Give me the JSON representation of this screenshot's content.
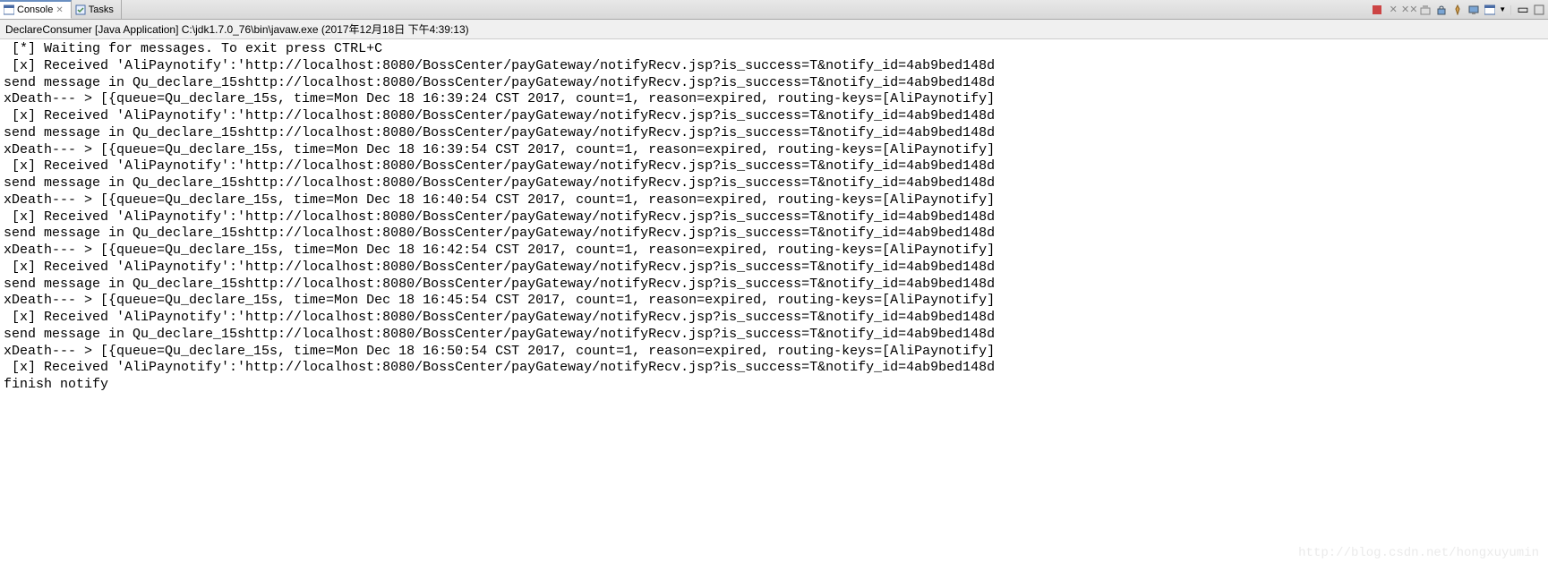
{
  "tabs": [
    {
      "label": "Console",
      "active": true,
      "icon": "console-icon"
    },
    {
      "label": "Tasks",
      "active": false,
      "icon": "tasks-icon"
    }
  ],
  "toolbar": {
    "icons": [
      "terminate-icon",
      "terminate-all-icon",
      "remove-all-icon",
      "clear-icon",
      "scroll-lock-icon",
      "pin-icon",
      "display-icon",
      "open-console-icon",
      "minimize-icon",
      "maximize-icon"
    ]
  },
  "launch": "DeclareConsumer [Java Application] C:\\jdk1.7.0_76\\bin\\javaw.exe (2017年12月18日 下午4:39:13)",
  "output": [
    " [*] Waiting for messages. To exit press CTRL+C",
    " [x] Received 'AliPaynotify':'http://localhost:8080/BossCenter/payGateway/notifyRecv.jsp?is_success=T&notify_id=4ab9bed148d",
    "send message in Qu_declare_15shttp://localhost:8080/BossCenter/payGateway/notifyRecv.jsp?is_success=T&notify_id=4ab9bed148d",
    "xDeath--- > [{queue=Qu_declare_15s, time=Mon Dec 18 16:39:24 CST 2017, count=1, reason=expired, routing-keys=[AliPaynotify]",
    " [x] Received 'AliPaynotify':'http://localhost:8080/BossCenter/payGateway/notifyRecv.jsp?is_success=T&notify_id=4ab9bed148d",
    "send message in Qu_declare_15shttp://localhost:8080/BossCenter/payGateway/notifyRecv.jsp?is_success=T&notify_id=4ab9bed148d",
    "xDeath--- > [{queue=Qu_declare_15s, time=Mon Dec 18 16:39:54 CST 2017, count=1, reason=expired, routing-keys=[AliPaynotify]",
    " [x] Received 'AliPaynotify':'http://localhost:8080/BossCenter/payGateway/notifyRecv.jsp?is_success=T&notify_id=4ab9bed148d",
    "send message in Qu_declare_15shttp://localhost:8080/BossCenter/payGateway/notifyRecv.jsp?is_success=T&notify_id=4ab9bed148d",
    "xDeath--- > [{queue=Qu_declare_15s, time=Mon Dec 18 16:40:54 CST 2017, count=1, reason=expired, routing-keys=[AliPaynotify]",
    " [x] Received 'AliPaynotify':'http://localhost:8080/BossCenter/payGateway/notifyRecv.jsp?is_success=T&notify_id=4ab9bed148d",
    "send message in Qu_declare_15shttp://localhost:8080/BossCenter/payGateway/notifyRecv.jsp?is_success=T&notify_id=4ab9bed148d",
    "xDeath--- > [{queue=Qu_declare_15s, time=Mon Dec 18 16:42:54 CST 2017, count=1, reason=expired, routing-keys=[AliPaynotify]",
    " [x] Received 'AliPaynotify':'http://localhost:8080/BossCenter/payGateway/notifyRecv.jsp?is_success=T&notify_id=4ab9bed148d",
    "send message in Qu_declare_15shttp://localhost:8080/BossCenter/payGateway/notifyRecv.jsp?is_success=T&notify_id=4ab9bed148d",
    "xDeath--- > [{queue=Qu_declare_15s, time=Mon Dec 18 16:45:54 CST 2017, count=1, reason=expired, routing-keys=[AliPaynotify]",
    " [x] Received 'AliPaynotify':'http://localhost:8080/BossCenter/payGateway/notifyRecv.jsp?is_success=T&notify_id=4ab9bed148d",
    "send message in Qu_declare_15shttp://localhost:8080/BossCenter/payGateway/notifyRecv.jsp?is_success=T&notify_id=4ab9bed148d",
    "xDeath--- > [{queue=Qu_declare_15s, time=Mon Dec 18 16:50:54 CST 2017, count=1, reason=expired, routing-keys=[AliPaynotify]",
    " [x] Received 'AliPaynotify':'http://localhost:8080/BossCenter/payGateway/notifyRecv.jsp?is_success=T&notify_id=4ab9bed148d",
    "finish notify"
  ],
  "watermark": "http://blog.csdn.net/hongxuyumin"
}
